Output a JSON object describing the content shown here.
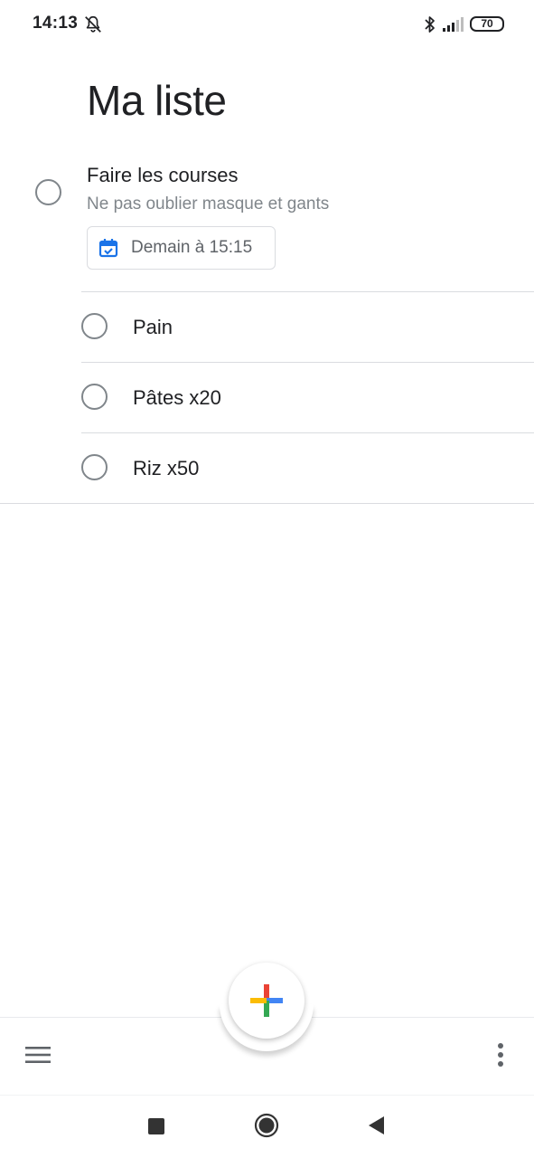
{
  "status_bar": {
    "time": "14:13",
    "battery": "70",
    "icons": [
      "bell-off-icon",
      "bluetooth-icon",
      "signal-icon",
      "battery-icon"
    ]
  },
  "list": {
    "title": "Ma liste"
  },
  "tasks": [
    {
      "title": "Faire les courses",
      "notes": "Ne pas oublier masque et gants",
      "due": "Demain à 15:15",
      "completed": false
    },
    {
      "title": "Pain",
      "completed": false
    },
    {
      "title": "Pâtes x20",
      "completed": false
    },
    {
      "title": "Riz x50",
      "completed": false
    }
  ],
  "bottom_bar": {
    "icons": [
      "menu-icon",
      "add-task-icon",
      "more-vert-icon"
    ]
  },
  "nav_bar": {
    "icons": [
      "recents-icon",
      "home-icon",
      "back-icon"
    ]
  },
  "colors": {
    "accent_blue": "#1a73e8",
    "plus_blue": "#4285f4",
    "plus_red": "#ea4335",
    "plus_yellow": "#fbbc05",
    "plus_green": "#34a853",
    "text_primary": "#202124",
    "text_secondary": "#80868b"
  }
}
